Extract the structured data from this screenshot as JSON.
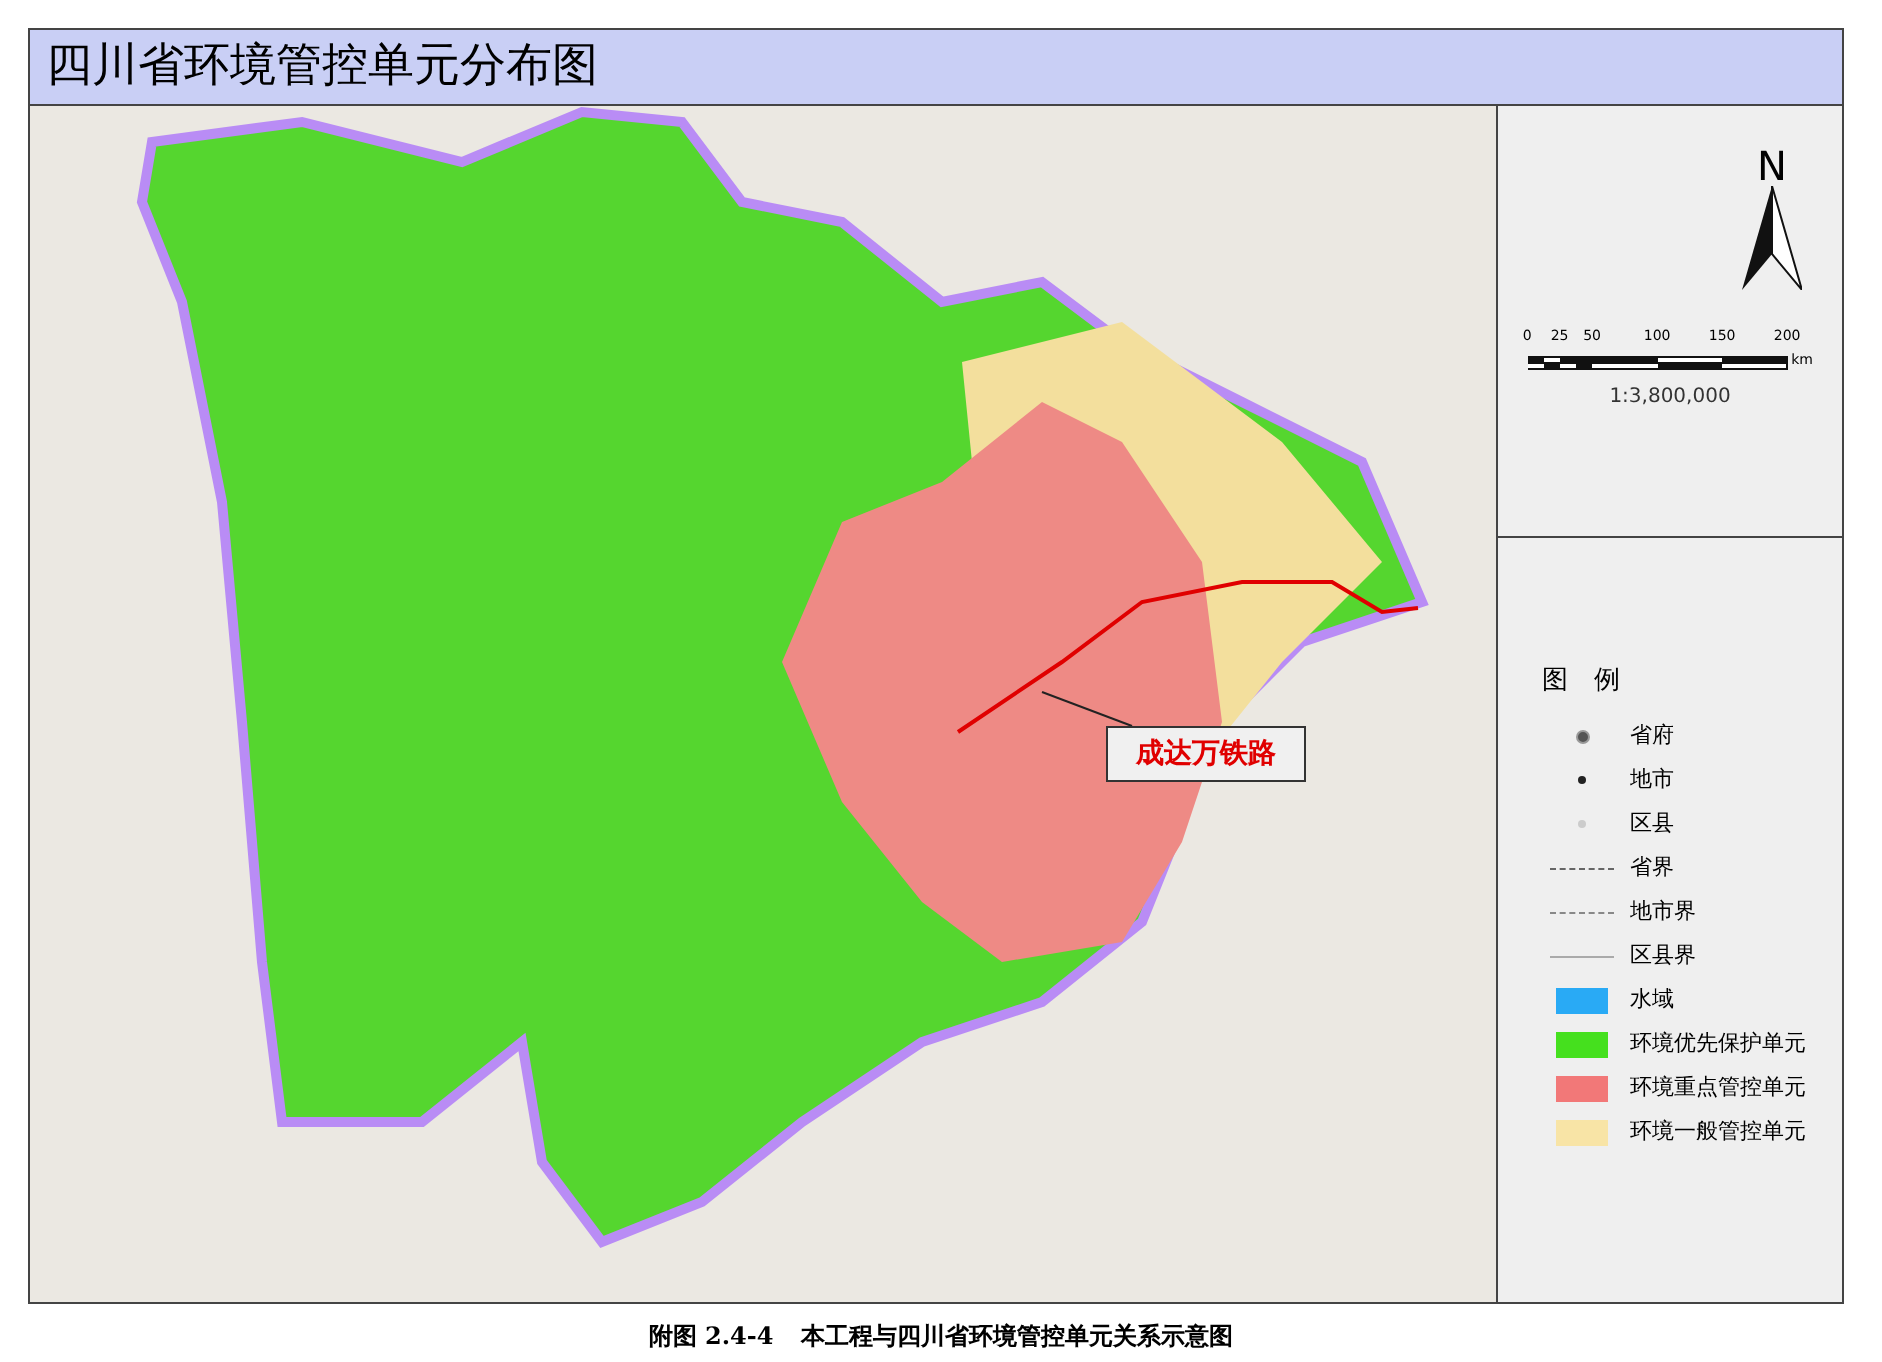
{
  "title": "四川省环境管控单元分布图",
  "map": {
    "annotation": "成达万铁路"
  },
  "north_arrow": {
    "label": "N"
  },
  "scale_bar": {
    "ticks": [
      "0",
      "25",
      "50",
      "100",
      "150",
      "200"
    ],
    "unit": "km",
    "ratio": "1:3,800,000"
  },
  "legend": {
    "title": "图　例",
    "items": [
      {
        "kind": "capital",
        "label": "省府"
      },
      {
        "kind": "city",
        "label": "地市"
      },
      {
        "kind": "county",
        "label": "区县"
      },
      {
        "kind": "provinceline",
        "label": "省界"
      },
      {
        "kind": "cityline",
        "label": "地市界"
      },
      {
        "kind": "countyline",
        "label": "区县界"
      },
      {
        "kind": "swatch",
        "label": "水域",
        "color": "#29aaf5"
      },
      {
        "kind": "swatch",
        "label": "环境优先保护单元",
        "color": "#45e01e"
      },
      {
        "kind": "swatch",
        "label": "环境重点管控单元",
        "color": "#f27878"
      },
      {
        "kind": "swatch",
        "label": "环境一般管控单元",
        "color": "#f8e4a6"
      }
    ]
  },
  "caption": {
    "number": "附图 2.4-4",
    "text": "本工程与四川省环境管控单元关系示意图"
  }
}
